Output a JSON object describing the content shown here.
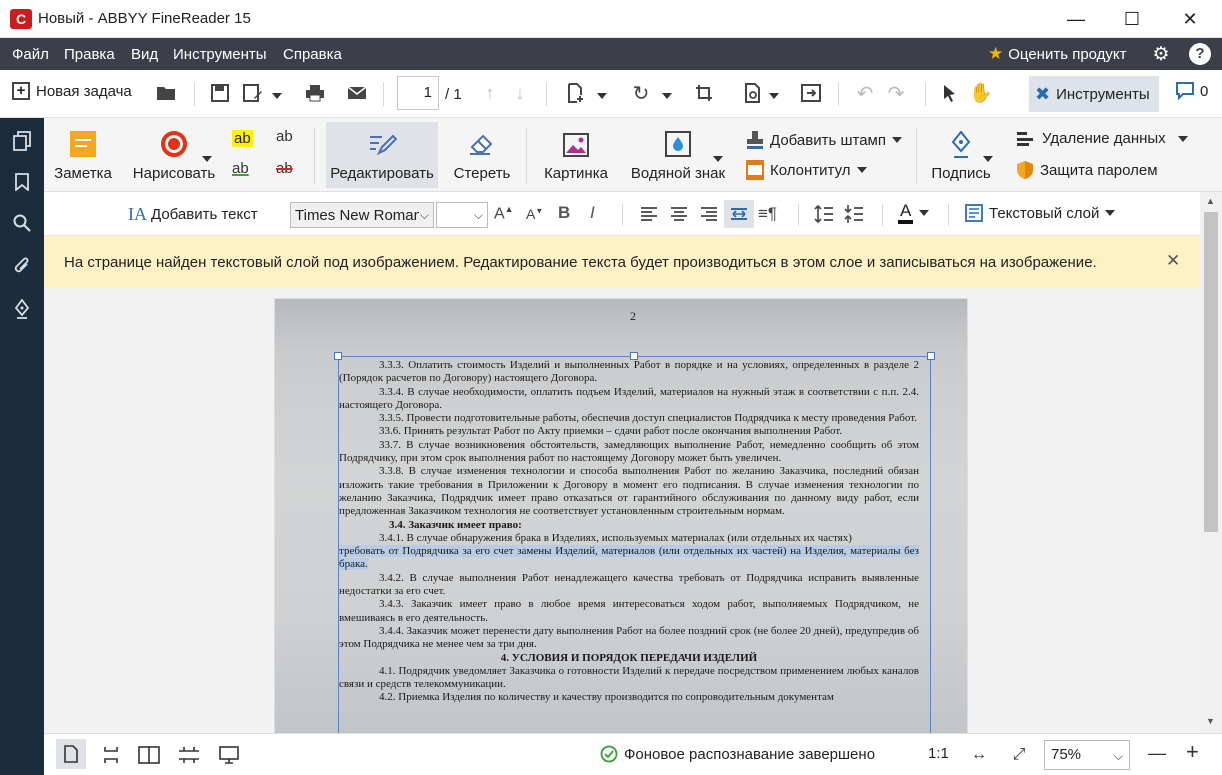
{
  "window": {
    "title": "Новый - ABBYY FineReader 15",
    "logo_letter": "C",
    "minimize": "—",
    "maximize": "☐",
    "close": "✕"
  },
  "menu": {
    "items": [
      "Файл",
      "Правка",
      "Вид",
      "Инструменты",
      "Справка"
    ],
    "rate_label": "Оценить продукт"
  },
  "toolbar": {
    "new_task": "Новая задача",
    "page_value": "1",
    "page_total": "/ 1",
    "tools_label": "Инструменты",
    "comments_count": "0"
  },
  "ribbon": {
    "note": "Заметка",
    "draw": "Нарисовать",
    "edit": "Редактировать",
    "erase": "Стереть",
    "picture": "Картинка",
    "watermark": "Водяной знак",
    "add_stamp": "Добавить штамп",
    "header_footer": "Колонтитул",
    "signature": "Подпись",
    "redact": "Удаление данных",
    "password": "Защита паролем",
    "hl_ab": "ab"
  },
  "format": {
    "add_text": "Добавить текст",
    "font": "Times New Roman",
    "size": "",
    "bold": "B",
    "italic": "I",
    "text_layer": "Текстовый слой"
  },
  "notification": {
    "text": "На странице найден текстовый слой под изображением. Редактирование текста будет производиться в этом слое и записываться на изображение."
  },
  "document": {
    "page_number": "2",
    "paragraphs": [
      {
        "cls": "ind",
        "text": "3.3.3. Оплатить стоимость Изделий и выполненных Работ в порядке и на условиях, определенных в разделе 2 (Порядок расчетов по Договору) настоящего Договора."
      },
      {
        "cls": "ind",
        "text": "3.3.4. В случае необходимости, оплатить подъем Изделий, материалов на нужный этаж в соответствии с п.п. 2.4. настоящего Договора."
      },
      {
        "cls": "ind",
        "text": "3.3.5. Провести подготовительные работы, обеспечив доступ специалистов Подрядчика к месту проведения Работ."
      },
      {
        "cls": "ind",
        "text": "33.6. Принять результат Работ по Акту приемки – сдачи работ после окончания выполнения Работ."
      },
      {
        "cls": "ind",
        "text": "33.7. В случае возникновения обстоятельств, замедляющих выполнение Работ, немедленно сообщить об этом Подрядчику, при этом срок выполнения работ по настоящему Договору может быть увеличен."
      },
      {
        "cls": "ind",
        "text": "3.3.8. В случае изменения технологии и способа выполнения Работ по желанию Заказчика, последний обязан изложить такие требования в Приложении к Договору в момент его подписания. В случае изменения технологии по желанию Заказчика, Подрядчик имеет право отказаться от гарантийного обслуживания по данному виду работ, если предложенная Заказчиком технология не соответствует установленным строительным нормам."
      },
      {
        "cls": "h",
        "text": "3.4. Заказчик имеет право:"
      },
      {
        "cls": "ind",
        "text": "3.4.1. В случае обнаружения брака в Изделиях, используемых материалах (или отдельных их частях)"
      },
      {
        "cls": "sel",
        "text": "требовать от Подрядчика за его счет замены Изделий, материалов (или отдельных их частей) на Изделия, материалы без брака."
      },
      {
        "cls": "ind",
        "text": "3.4.2. В случае выполнения Работ ненадлежащего качества требовать от Подрядчика исправить выявленные недостатки за его счет."
      },
      {
        "cls": "ind",
        "text": "3.4.3. Заказчик имеет право в любое время интересоваться ходом работ, выполняемых Подрядчиком, не вмешиваясь в его деятельность."
      },
      {
        "cls": "ind",
        "text": "3.4.4. Заказчик может перенести дату выполнения Работ на более поздний срок (не более 20 дней), предупредив об этом Подрядчика не менее чем за три дня."
      },
      {
        "cls": "hc",
        "text": "4. УСЛОВИЯ И ПОРЯДОК ПЕРЕДАЧИ ИЗДЕЛИЙ"
      },
      {
        "cls": "ind",
        "text": "4.1. Подрядчик уведомляет Заказчика о готовности Изделий к передаче посредством применением любых каналов связи и средств телекоммуникации."
      },
      {
        "cls": "ind",
        "text": "4.2. Приемка Изделия по количеству и качеству производится по сопроводительным документам"
      }
    ]
  },
  "status": {
    "recognition": "Фоновое распознавание завершено",
    "ratio": "1:1",
    "zoom": "75%",
    "zoom_out": "—",
    "zoom_in": "+"
  },
  "colors": {
    "menubar": "#3c3f4a",
    "sidebar": "#1b2d3d",
    "notification": "#fdf1c5",
    "accent": "#2b6cb0"
  }
}
